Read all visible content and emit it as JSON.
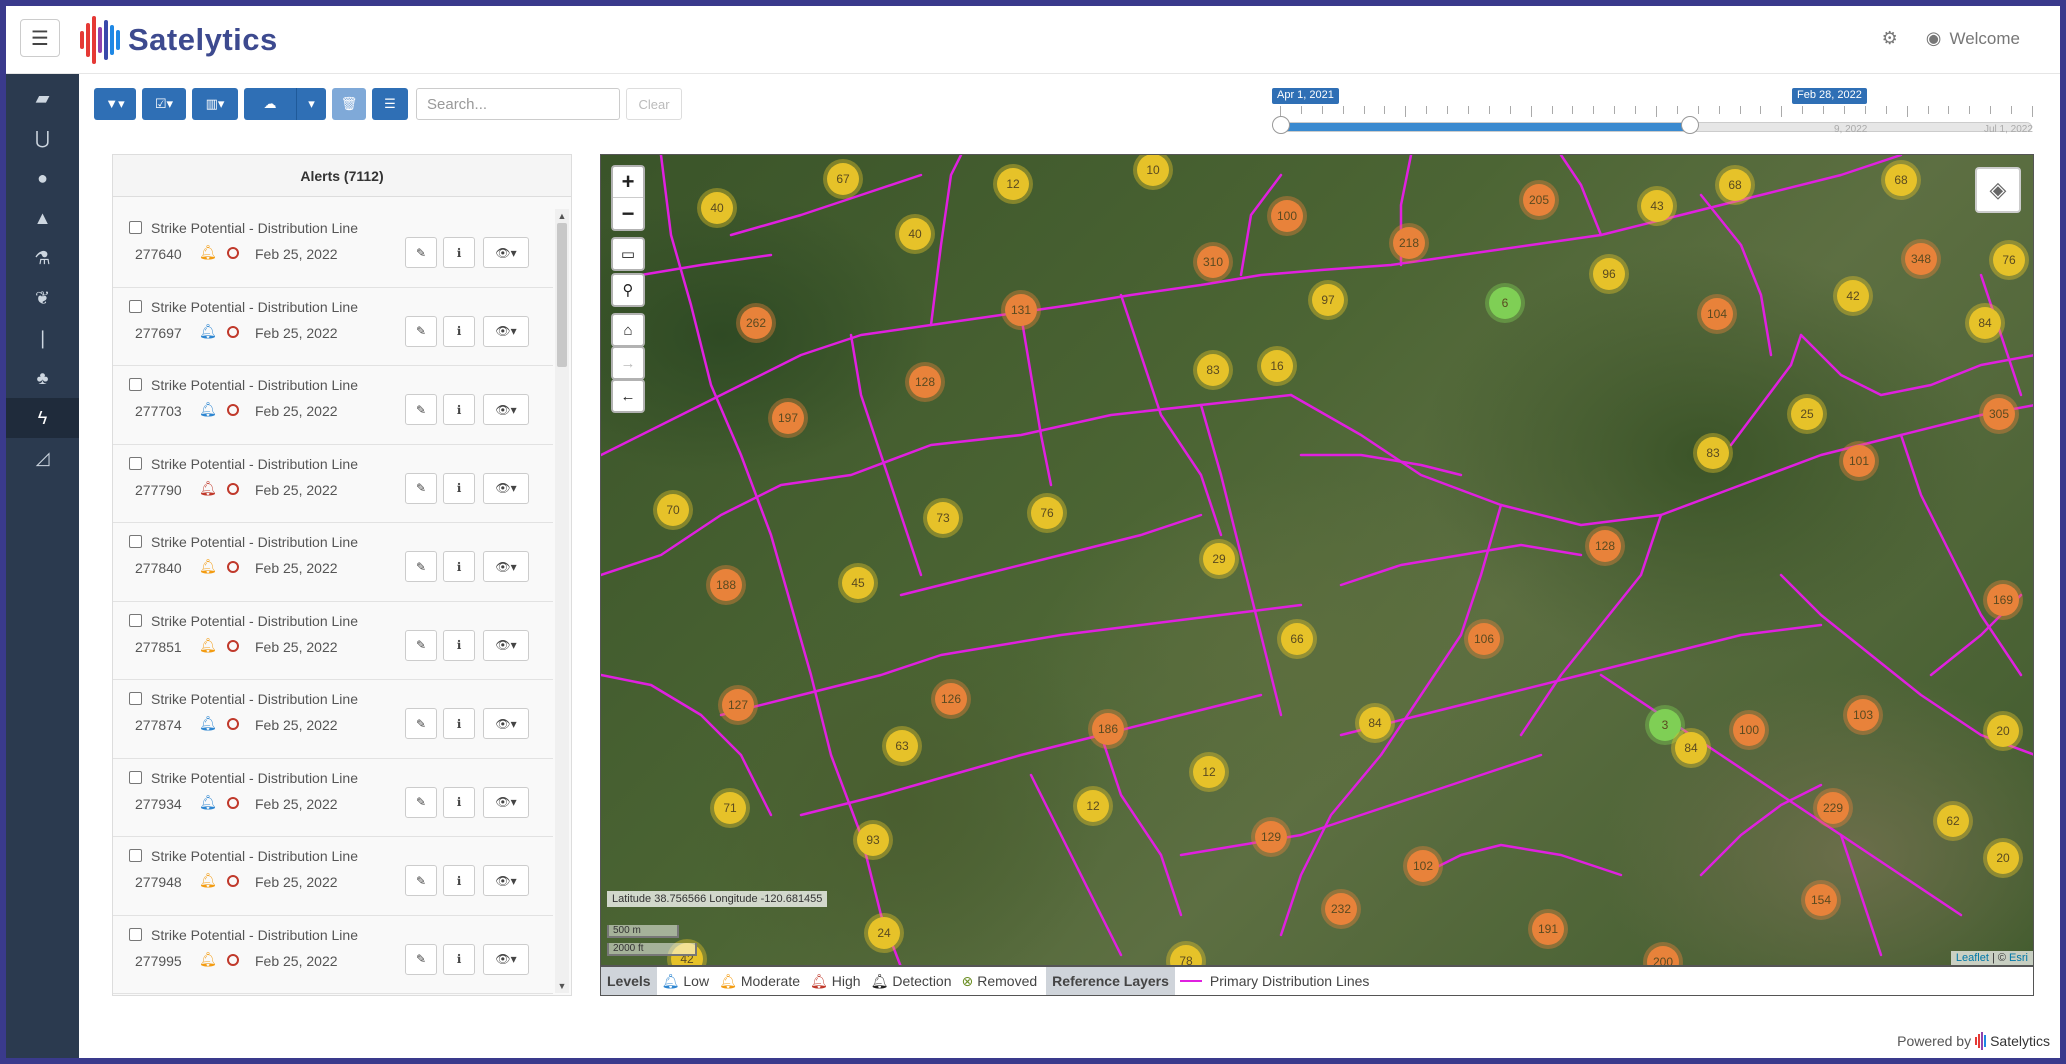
{
  "app": {
    "name": "Satelytics"
  },
  "header": {
    "welcome": "Welcome"
  },
  "toolbar": {
    "search_placeholder": "Search...",
    "clear_label": "Clear"
  },
  "timeline": {
    "start_tag": "Apr 1, 2021",
    "end_tag": "Feb 28, 2022",
    "label_mid": "9, 2022",
    "label_end": "Jul 1, 2022",
    "selection_end_fraction": 0.545
  },
  "alerts": {
    "title": "Alerts (7112)",
    "items": [
      {
        "title": "Strike Potential - Distribution Line",
        "id": "277640",
        "level": "moderate",
        "date": "Feb 25, 2022"
      },
      {
        "title": "Strike Potential - Distribution Line",
        "id": "277697",
        "level": "low",
        "date": "Feb 25, 2022"
      },
      {
        "title": "Strike Potential - Distribution Line",
        "id": "277703",
        "level": "low",
        "date": "Feb 25, 2022"
      },
      {
        "title": "Strike Potential - Distribution Line",
        "id": "277790",
        "level": "high",
        "date": "Feb 25, 2022"
      },
      {
        "title": "Strike Potential - Distribution Line",
        "id": "277840",
        "level": "moderate",
        "date": "Feb 25, 2022"
      },
      {
        "title": "Strike Potential - Distribution Line",
        "id": "277851",
        "level": "moderate",
        "date": "Feb 25, 2022"
      },
      {
        "title": "Strike Potential - Distribution Line",
        "id": "277874",
        "level": "low",
        "date": "Feb 25, 2022"
      },
      {
        "title": "Strike Potential - Distribution Line",
        "id": "277934",
        "level": "low",
        "date": "Feb 25, 2022"
      },
      {
        "title": "Strike Potential - Distribution Line",
        "id": "277948",
        "level": "moderate",
        "date": "Feb 25, 2022"
      },
      {
        "title": "Strike Potential - Distribution Line",
        "id": "277995",
        "level": "moderate",
        "date": "Feb 25, 2022"
      }
    ]
  },
  "map": {
    "coords_text": "Latitude 38.756566 Longitude -120.681455",
    "scale_metric": "500 m",
    "scale_imperial": "2000 ft",
    "attribution_leaflet": "Leaflet",
    "attribution_sep": " | © ",
    "attribution_esri": "Esri",
    "clusters": [
      {
        "n": "67",
        "c": "y"
      },
      {
        "n": "10",
        "c": "y"
      },
      {
        "n": "12",
        "c": "y"
      },
      {
        "n": "40",
        "c": "y"
      },
      {
        "n": "100",
        "c": "o"
      },
      {
        "n": "205",
        "c": "o"
      },
      {
        "n": "43",
        "c": "y"
      },
      {
        "n": "68",
        "c": "y"
      },
      {
        "n": "68",
        "c": "y"
      },
      {
        "n": "40",
        "c": "y"
      },
      {
        "n": "310",
        "c": "o"
      },
      {
        "n": "218",
        "c": "o"
      },
      {
        "n": "96",
        "c": "y"
      },
      {
        "n": "348",
        "c": "o"
      },
      {
        "n": "76",
        "c": "y"
      },
      {
        "n": "97",
        "c": "y"
      },
      {
        "n": "6",
        "c": "g"
      },
      {
        "n": "42",
        "c": "y"
      },
      {
        "n": "131",
        "c": "o"
      },
      {
        "n": "104",
        "c": "o"
      },
      {
        "n": "262",
        "c": "o"
      },
      {
        "n": "83",
        "c": "y"
      },
      {
        "n": "16",
        "c": "y"
      },
      {
        "n": "84",
        "c": "y"
      },
      {
        "n": "128",
        "c": "o"
      },
      {
        "n": "197",
        "c": "o"
      },
      {
        "n": "25",
        "c": "y"
      },
      {
        "n": "305",
        "c": "o"
      },
      {
        "n": "83",
        "c": "y"
      },
      {
        "n": "101",
        "c": "o"
      },
      {
        "n": "70",
        "c": "y"
      },
      {
        "n": "73",
        "c": "y"
      },
      {
        "n": "76",
        "c": "y"
      },
      {
        "n": "29",
        "c": "y"
      },
      {
        "n": "128",
        "c": "o"
      },
      {
        "n": "188",
        "c": "o"
      },
      {
        "n": "45",
        "c": "y"
      },
      {
        "n": "169",
        "c": "o"
      },
      {
        "n": "66",
        "c": "y"
      },
      {
        "n": "106",
        "c": "o"
      },
      {
        "n": "127",
        "c": "o"
      },
      {
        "n": "126",
        "c": "o"
      },
      {
        "n": "3",
        "c": "g"
      },
      {
        "n": "103",
        "c": "o"
      },
      {
        "n": "186",
        "c": "o"
      },
      {
        "n": "84",
        "c": "y"
      },
      {
        "n": "100",
        "c": "o"
      },
      {
        "n": "20",
        "c": "y"
      },
      {
        "n": "63",
        "c": "y"
      },
      {
        "n": "84",
        "c": "y"
      },
      {
        "n": "71",
        "c": "y"
      },
      {
        "n": "12",
        "c": "y"
      },
      {
        "n": "229",
        "c": "o"
      },
      {
        "n": "12",
        "c": "y"
      },
      {
        "n": "62",
        "c": "y"
      },
      {
        "n": "93",
        "c": "y"
      },
      {
        "n": "129",
        "c": "o"
      },
      {
        "n": "20",
        "c": "y"
      },
      {
        "n": "102",
        "c": "o"
      },
      {
        "n": "154",
        "c": "o"
      },
      {
        "n": "191",
        "c": "o"
      },
      {
        "n": "232",
        "c": "o"
      },
      {
        "n": "42",
        "c": "y"
      },
      {
        "n": "78",
        "c": "y"
      },
      {
        "n": "200",
        "c": "o"
      },
      {
        "n": "24",
        "c": "y"
      }
    ]
  },
  "legend": {
    "levels_label": "Levels",
    "low": "Low",
    "moderate": "Moderate",
    "high": "High",
    "detection": "Detection",
    "removed": "Removed",
    "reference_label": "Reference Layers",
    "primary_lines": "Primary Distribution Lines"
  },
  "footer": {
    "powered_by": "Powered by",
    "brand": "Satelytics"
  },
  "colors": {
    "low": "#2e86d1",
    "moderate": "#f39c12",
    "high": "#c0392b",
    "detection": "#222222",
    "removed": "#6b8e23",
    "line": "#e020e0",
    "cluster_yellow": "#e6c229",
    "cluster_orange": "#e8823a",
    "cluster_green": "#7fcf55"
  }
}
